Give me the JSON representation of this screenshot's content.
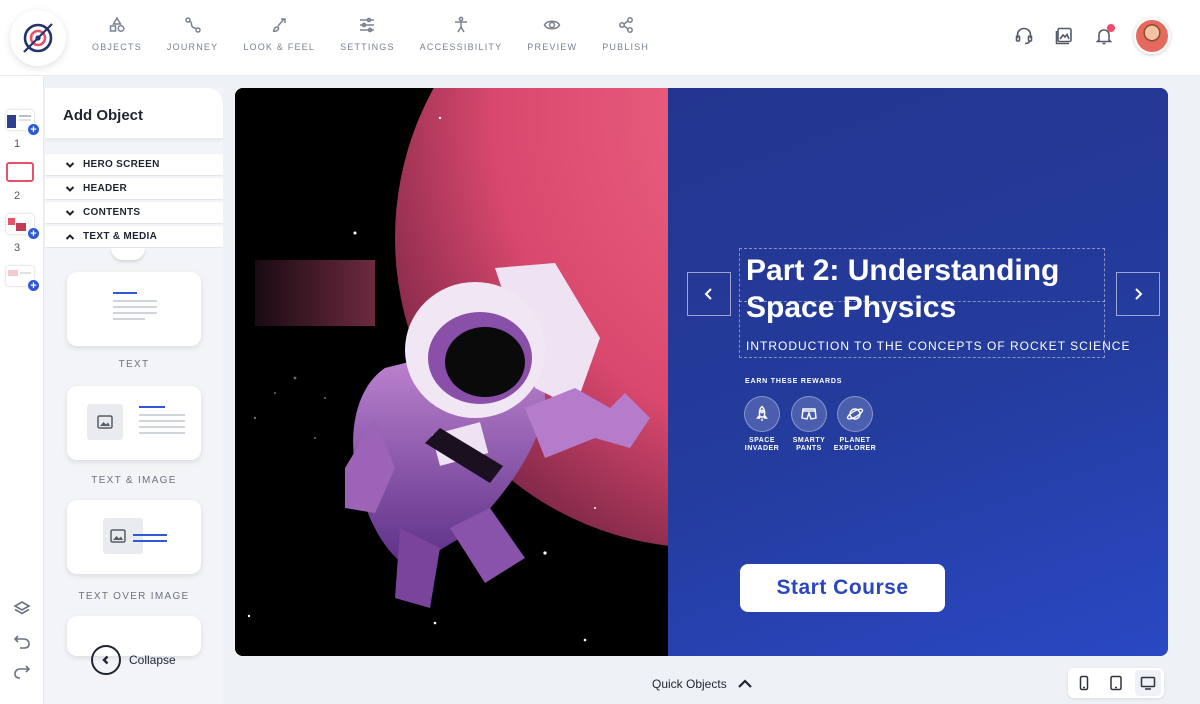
{
  "nav": {
    "items": [
      {
        "label": "OBJECTS",
        "icon": "shapes-icon"
      },
      {
        "label": "JOURNEY",
        "icon": "path-icon"
      },
      {
        "label": "LOOK & FEEL",
        "icon": "brush-icon"
      },
      {
        "label": "SETTINGS",
        "icon": "sliders-icon"
      },
      {
        "label": "ACCESSIBILITY",
        "icon": "accessibility-icon"
      },
      {
        "label": "PREVIEW",
        "icon": "eye-icon"
      },
      {
        "label": "PUBLISH",
        "icon": "share-icon"
      }
    ]
  },
  "top_right": {
    "icons": [
      "headset-icon",
      "gallery-icon",
      "bell-icon",
      "avatar"
    ]
  },
  "slides": {
    "numbers": [
      "1",
      "2",
      "3"
    ],
    "selected": "1"
  },
  "panel": {
    "title": "Add Object",
    "sections": [
      "HERO SCREEN",
      "HEADER",
      "CONTENTS",
      "TEXT & MEDIA"
    ],
    "expanded": "TEXT & MEDIA",
    "cards": [
      "TEXT",
      "TEXT & IMAGE",
      "TEXT OVER IMAGE"
    ],
    "collapse_label": "Collapse"
  },
  "hero": {
    "title": "Part 2: Understanding Space Physics",
    "subtitle": "INTRODUCTION TO THE CONCEPTS OF ROCKET SCIENCE",
    "rewards_label": "EARN THESE REWARDS",
    "rewards": [
      {
        "line1": "SPACE",
        "line2": "INVADER",
        "icon": "rocket-icon"
      },
      {
        "line1": "SMARTY",
        "line2": "PANTS",
        "icon": "shorts-icon"
      },
      {
        "line1": "PLANET",
        "line2": "EXPLORER",
        "icon": "planet-icon"
      }
    ],
    "cta": "Start Course"
  },
  "bottom": {
    "quick_objects": "Quick Objects",
    "devices": [
      "phone-icon",
      "tablet-icon",
      "desktop-icon"
    ],
    "active_device": "desktop-icon"
  },
  "colors": {
    "accent_blue": "#2f59d8",
    "hero_blue": "#243c9e",
    "selection_red": "#e8506a",
    "planet_pink": "#e65c7a"
  }
}
